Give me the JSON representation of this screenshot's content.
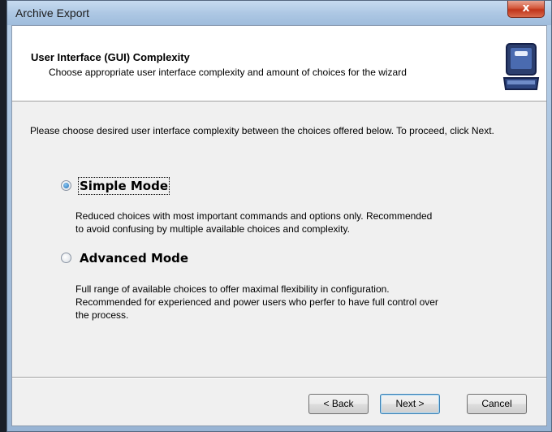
{
  "window": {
    "title": "Archive Export",
    "close_label": "x"
  },
  "header": {
    "title": "User Interface (GUI) Complexity",
    "subtitle": "Choose appropriate user interface complexity and amount of choices for the wizard",
    "icon": "briefcase-icon"
  },
  "intro": "Please choose desired user interface complexity between the choices offered below. To proceed, click Next.",
  "options": [
    {
      "label": "Simple Mode",
      "checked": true,
      "desc_lines": [
        "Reduced choices with most important commands and options only. Recommended",
        "to avoid confusing by multiple available choices and complexity."
      ]
    },
    {
      "label": "Advanced Mode",
      "checked": false,
      "desc_lines": [
        "Full range of available choices to offer maximal flexibility in configuration.",
        "Recommended for experienced and power users who perfer to have full control over",
        "the process."
      ]
    }
  ],
  "buttons": {
    "back": "< Back",
    "next": "Next >",
    "cancel": "Cancel"
  }
}
